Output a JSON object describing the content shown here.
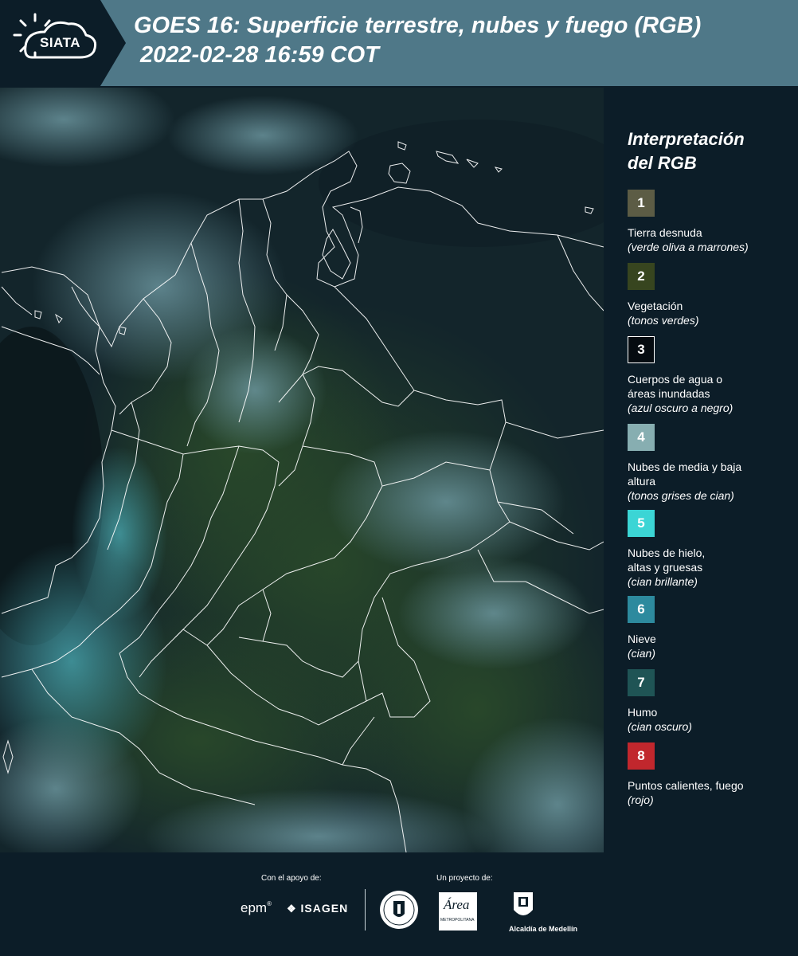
{
  "header": {
    "logo_text": "SIATA",
    "title_line1": "GOES 16: Superficie terrestre, nubes y fuego (RGB)",
    "title_line2": "2022-02-28 16:59 COT"
  },
  "legend": {
    "title_line1": "Interpretación",
    "title_line2": "del RGB",
    "items": [
      {
        "number": "1",
        "color": "#5c5c45",
        "label": "Tierra desnuda",
        "description": "(verde oliva a marrones)"
      },
      {
        "number": "2",
        "color": "#37451f",
        "label": "Vegetación",
        "description": "(tonos verdes)"
      },
      {
        "number": "3",
        "color": "#050b10",
        "label": "Cuerpos de agua o áreas inundadas",
        "description": "(azul oscuro a negro)"
      },
      {
        "number": "4",
        "color": "#87aeb1",
        "label": "Nubes de media y baja altura",
        "description": "(tonos grises de cian)"
      },
      {
        "number": "5",
        "color": "#3bd5d5",
        "label": "Nubes de hielo, altas y gruesas",
        "description": "(cian brillante)"
      },
      {
        "number": "6",
        "color": "#2d8a9e",
        "label": "Nieve",
        "description": "(cian)"
      },
      {
        "number": "7",
        "color": "#1f5455",
        "label": "Humo",
        "description": "(cian oscuro)"
      },
      {
        "number": "8",
        "color": "#c1272d",
        "label": "Puntos calientes, fuego",
        "description": "(rojo)"
      }
    ]
  },
  "footer": {
    "support_label": "Con el apoyo de:",
    "project_label": "Un proyecto de:",
    "sponsor1": "epm",
    "sponsor2": "ISAGEN",
    "area_text": "Área",
    "area_sub": "METROPOLITANA",
    "alcaldia": "Alcaldía de Medellín"
  }
}
